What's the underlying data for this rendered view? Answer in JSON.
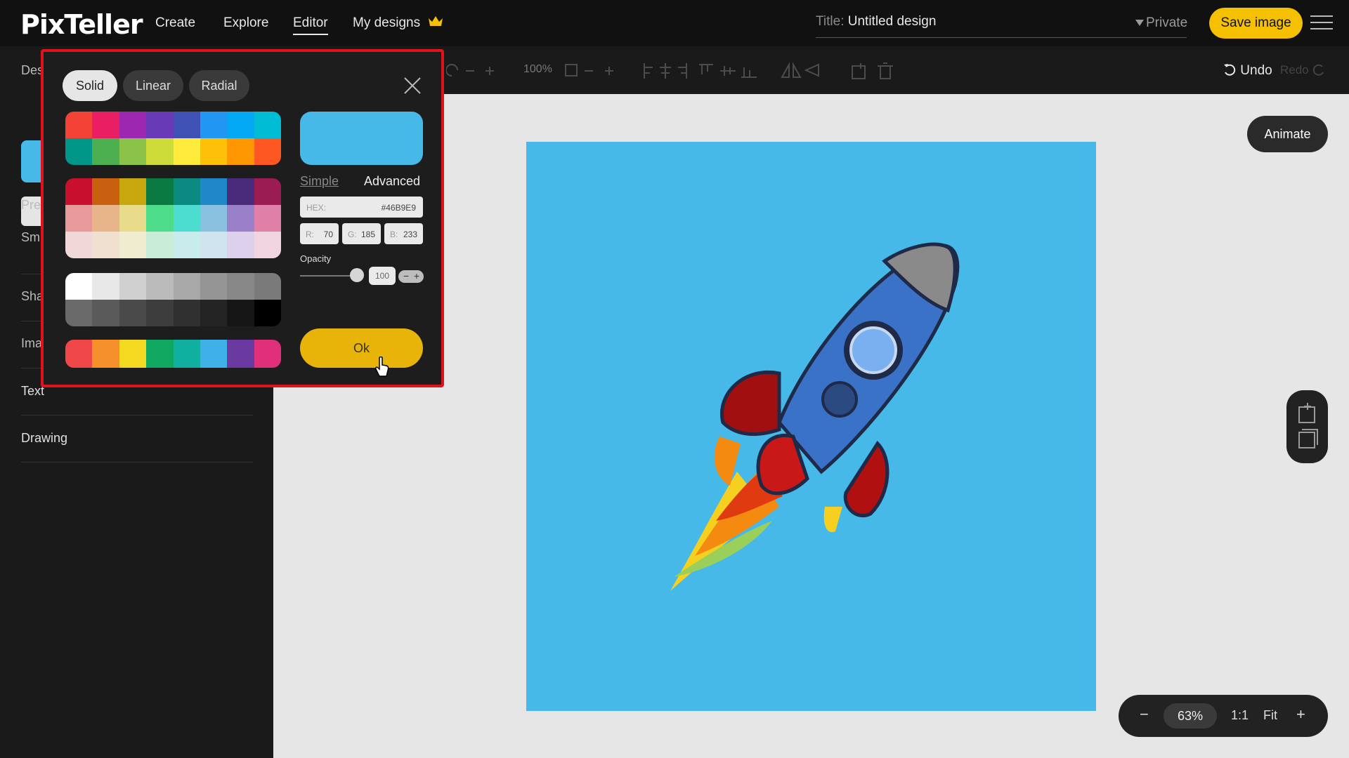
{
  "app": {
    "logo": "PixTeller",
    "nav": [
      "Create",
      "Explore",
      "Editor",
      "My designs"
    ],
    "title_label": "Title:",
    "title_value": "Untitled design",
    "privacy": "Private",
    "save_button": "Save image"
  },
  "toolbar": {
    "zoom_text": "100%",
    "undo": "Undo",
    "redo": "Redo"
  },
  "sidebar": {
    "peek_labels": [
      "Des",
      "Pre",
      "Sm",
      "Sha",
      "Ima"
    ],
    "items": [
      "Text",
      "Drawing"
    ]
  },
  "picker": {
    "tabs": [
      "Solid",
      "Linear",
      "Radial"
    ],
    "active_tab": "Solid",
    "modes": {
      "simple": "Simple",
      "advanced": "Advanced"
    },
    "hex_label": "HEX:",
    "hex_value": "#46B9E9",
    "rgb": [
      {
        "label": "R:",
        "value": "70"
      },
      {
        "label": "G:",
        "value": "185"
      },
      {
        "label": "B:",
        "value": "233"
      }
    ],
    "opacity_label": "Opacity",
    "opacity_value": "100",
    "ok_button": "Ok",
    "palette_1": [
      [
        "#f44336",
        "#e91e63",
        "#9c27b0",
        "#673ab7",
        "#3f51b5",
        "#2196f3",
        "#03a9f4",
        "#00bcd4"
      ],
      [
        "#009688",
        "#4caf50",
        "#8bc34a",
        "#cddc39",
        "#ffeb3b",
        "#ffc107",
        "#ff9800",
        "#ff5722"
      ]
    ],
    "palette_2": [
      [
        "#c8102e",
        "#c8600f",
        "#c8a70f",
        "#0a7a42",
        "#0a8a80",
        "#1e88c8",
        "#4a2a7a",
        "#9a1c52"
      ],
      [
        "#e89a9a",
        "#e8b48a",
        "#e8dc8a",
        "#4cdc8a",
        "#4cdcd0",
        "#8ac0e0",
        "#9a80c8",
        "#e080a8"
      ],
      [
        "#f0d8d8",
        "#f0e0d0",
        "#f0ecd0",
        "#c8ecd8",
        "#c8ecec",
        "#d0e4f0",
        "#dcd0ec",
        "#f0d4e0"
      ]
    ],
    "palette_3": [
      [
        "#ffffff",
        "#e8e8e8",
        "#d0d0d0",
        "#bbbbbb",
        "#a8a8a8",
        "#959595",
        "#888888",
        "#7a7a7a"
      ],
      [
        "#6a6a6a",
        "#5a5a5a",
        "#4a4a4a",
        "#3d3d3d",
        "#303030",
        "#242424",
        "#161616",
        "#000000"
      ]
    ],
    "palette_4": [
      [
        "#f04848",
        "#f5902a",
        "#f5d820",
        "#10a860",
        "#10b0a0",
        "#40b0e8",
        "#6a3aa0",
        "#e0307a"
      ]
    ],
    "preview_color": "#46b9e9"
  },
  "canvas": {
    "background_color": "#46b9e9",
    "animate_button": "Animate",
    "zoom": "63%",
    "ratio": "1:1",
    "fit": "Fit"
  },
  "colors": {
    "accent": "#f5c000",
    "ok": "#e8b40a",
    "highlight_border": "#e0121b"
  }
}
